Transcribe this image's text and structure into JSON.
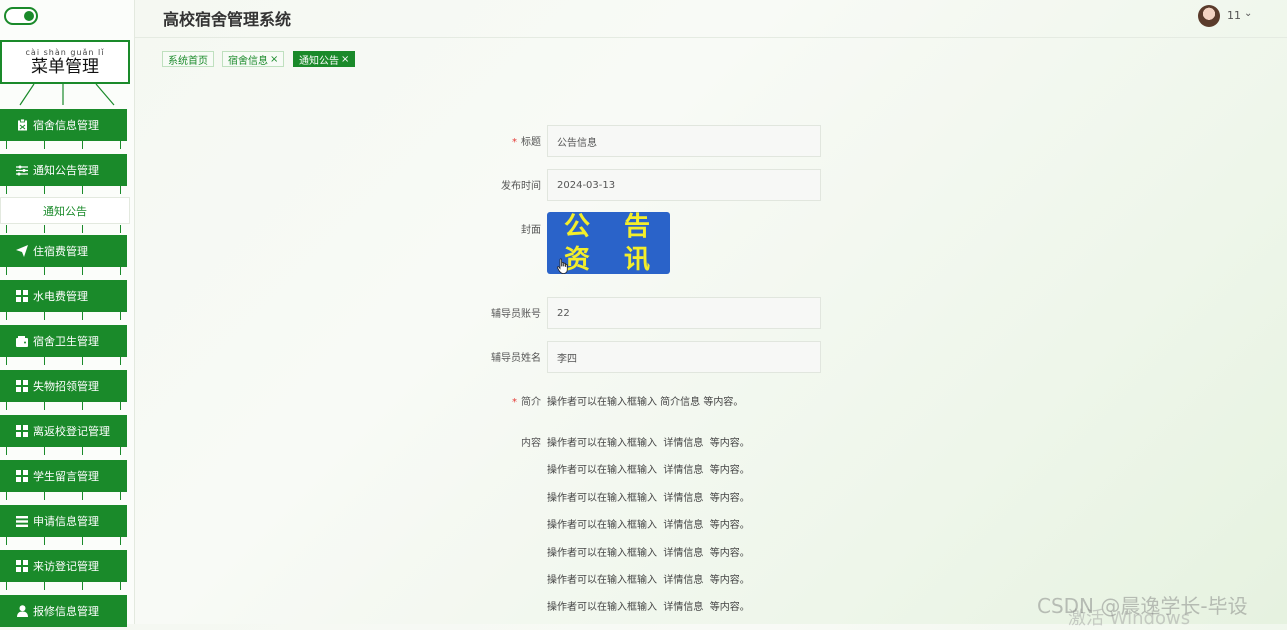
{
  "app": {
    "title": "高校宿舍管理系统",
    "user": "11",
    "caret": "⌄"
  },
  "sidebar": {
    "toggle_state": "on",
    "menu_title": {
      "pinyin": "cài shàn guǎn lǐ",
      "text": "菜单管理"
    },
    "items": [
      {
        "label": "宿舍信息管理",
        "icon": "clipboard-icon"
      },
      {
        "label": "通知公告管理",
        "icon": "sliders-icon"
      },
      {
        "label": "住宿费管理",
        "icon": "paper-plane-icon"
      },
      {
        "label": "水电费管理",
        "icon": "grid-icon"
      },
      {
        "label": "宿舍卫生管理",
        "icon": "wallet-icon"
      },
      {
        "label": "失物招领管理",
        "icon": "grid-icon"
      },
      {
        "label": "离返校登记管理",
        "icon": "grid-icon"
      },
      {
        "label": "学生留言管理",
        "icon": "grid-icon"
      },
      {
        "label": "申请信息管理",
        "icon": "list-icon"
      },
      {
        "label": "来访登记管理",
        "icon": "grid-icon"
      },
      {
        "label": "报修信息管理",
        "icon": "user-icon"
      }
    ],
    "subitem": "通知公告"
  },
  "tabs": [
    {
      "label": "系统首页",
      "closable": false,
      "active": false
    },
    {
      "label": "宿舍信息",
      "closable": true,
      "active": false
    },
    {
      "label": "通知公告",
      "closable": true,
      "active": true
    }
  ],
  "tab_close": "×",
  "form": {
    "title_label": "标题",
    "title_value": "公告信息",
    "date_label": "发布时间",
    "date_value": "2024-03-13",
    "cover_label": "封面",
    "cover_chars": [
      "公",
      "告",
      "资",
      "讯"
    ],
    "account_label": "辅导员账号",
    "account_value": "22",
    "name_label": "辅导员姓名",
    "name_value": "李四",
    "intro_label": "简介",
    "intro_value": "操作者可以在输入框输入 简介信息 等内容。",
    "content_label": "内容",
    "content_lines": [
      "操作者可以在输入框输入  详情信息  等内容。",
      "操作者可以在输入框输入  详情信息  等内容。",
      "操作者可以在输入框输入  详情信息  等内容。",
      "操作者可以在输入框输入  详情信息  等内容。",
      "操作者可以在输入框输入  详情信息  等内容。",
      "操作者可以在输入框输入  详情信息  等内容。",
      "操作者可以在输入框输入  详情信息  等内容。"
    ],
    "required_mark": "*"
  },
  "watermark": {
    "csdn": "CSDN @晨逸学长-毕设",
    "windows": "激活 Windows"
  },
  "colors": {
    "primary": "#1a8a2a",
    "cover_bg": "#2a63c9",
    "cover_text": "#f4ee2a"
  }
}
